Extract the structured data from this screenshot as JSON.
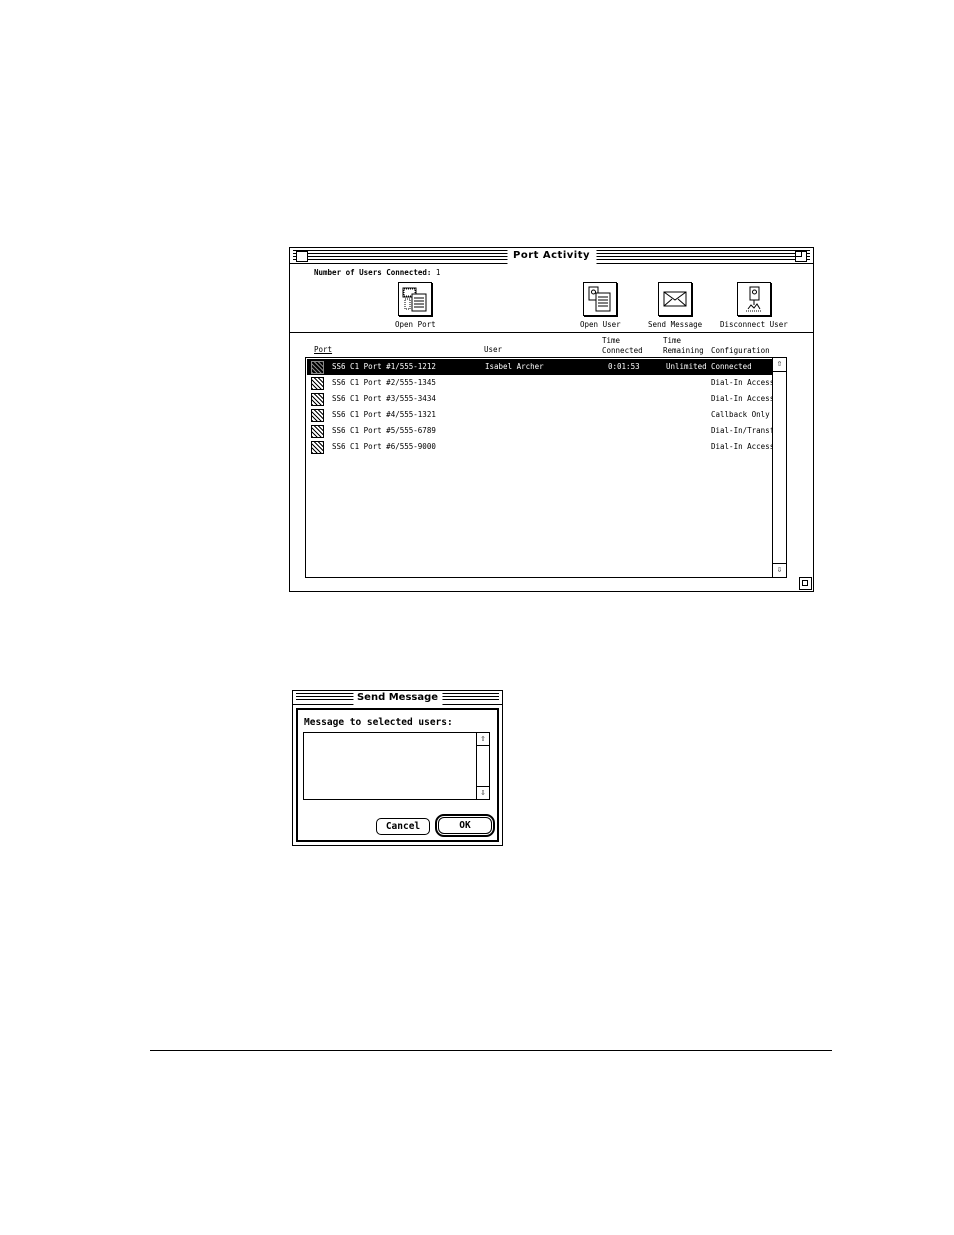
{
  "port_activity": {
    "title": "Port Activity",
    "users_connected_label": "Number of Users Connected:",
    "users_connected_count": "1",
    "toolbar": {
      "open_port": "Open Port",
      "open_user": "Open User",
      "send_message": "Send Message",
      "disconnect_user": "Disconnect User"
    },
    "columns": {
      "port": "Port",
      "user": "User",
      "time_connected_1": "Time",
      "time_connected_2": "Connected",
      "time_remaining_1": "Time",
      "time_remaining_2": "Remaining",
      "configuration": "Configuration"
    },
    "rows": [
      {
        "port": "SS6 C1 Port #1/555-1212",
        "user": "Isabel Archer",
        "time_connected": "0:01:53",
        "time_remaining": "Unlimited",
        "configuration": "Connected",
        "selected": true
      },
      {
        "port": "SS6 C1 Port #2/555-1345",
        "user": "",
        "time_connected": "",
        "time_remaining": "",
        "configuration": "Dial-In Access",
        "selected": false
      },
      {
        "port": "SS6 C1 Port #3/555-3434",
        "user": "",
        "time_connected": "",
        "time_remaining": "",
        "configuration": "Dial-In Access",
        "selected": false
      },
      {
        "port": "SS6 C1 Port #4/555-1321",
        "user": "",
        "time_connected": "",
        "time_remaining": "",
        "configuration": "Callback Only",
        "selected": false
      },
      {
        "port": "SS6 C1 Port #5/555-6789",
        "user": "",
        "time_connected": "",
        "time_remaining": "",
        "configuration": "Dial-In/Transfer",
        "selected": false
      },
      {
        "port": "SS6 C1 Port #6/555-9000",
        "user": "",
        "time_connected": "",
        "time_remaining": "",
        "configuration": "Dial-In Access",
        "selected": false
      }
    ]
  },
  "send_message": {
    "title": "Send Message",
    "label": "Message to selected users:",
    "message_value": "",
    "cancel": "Cancel",
    "ok": "OK"
  }
}
